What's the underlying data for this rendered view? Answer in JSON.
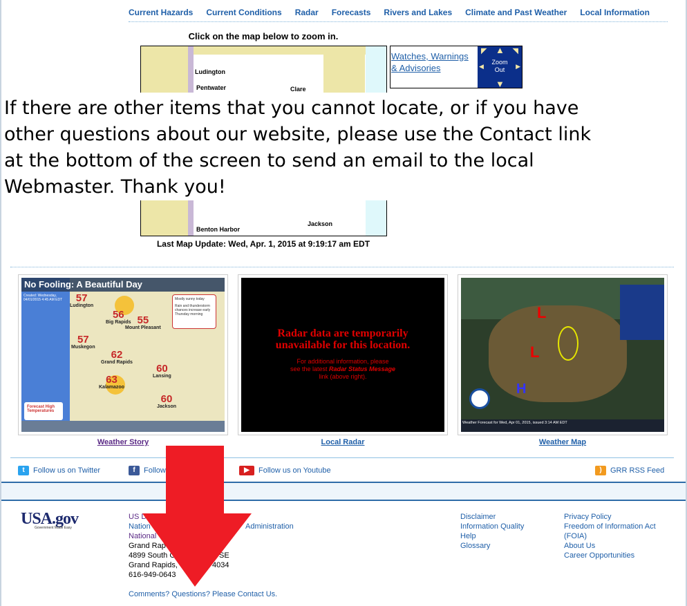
{
  "nav": [
    "Current Hazards",
    "Current Conditions",
    "Radar",
    "Forecasts",
    "Rivers and Lakes",
    "Climate and Past Weather",
    "Local Information"
  ],
  "map": {
    "instruction": "Click on the map below to zoom in.",
    "cities": [
      "Ludington",
      "Pentwater",
      "Clare",
      "Benton Harbor",
      "Jackson"
    ],
    "watches_link": "Watches, Warnings & Advisories",
    "zoom_out": "Zoom Out",
    "last_update": "Last Map Update: Wed, Apr. 1, 2015 at 9:19:17 am EDT"
  },
  "overlay_text": "If there are other items that you cannot locate, or if you have other questions about our website, please use the Contact link at the bottom of the screen to send an email to the local Webmaster. Thank you!",
  "panels": {
    "story": {
      "title": "No Fooling: A Beautiful Day",
      "created": "Created: Wednesday, 04/01/2015 4:45 AM EDT",
      "note1": "Mostly sunny today",
      "note2": "Rain and thunderstorm chances increase early Thursday morning",
      "legend": "Forecast High Temperatures",
      "temps": [
        {
          "v": "57",
          "c": "Ludington"
        },
        {
          "v": "56",
          "c": "Big Rapids"
        },
        {
          "v": "55",
          "c": "Mount Pleasant"
        },
        {
          "v": "57",
          "c": "Muskegon"
        },
        {
          "v": "62",
          "c": "Grand Rapids"
        },
        {
          "v": "60",
          "c": "Lansing"
        },
        {
          "v": "63",
          "c": "Kalamazoo"
        },
        {
          "v": "60",
          "c": "Jackson"
        }
      ],
      "label": "Weather Story"
    },
    "radar": {
      "headline": "Radar data are temporarily unavailable for this location.",
      "line1": "For additional information, please",
      "line2a": "see the latest ",
      "line2b": "Radar Status Message",
      "line3": "link (above right).",
      "label": "Local Radar"
    },
    "map": {
      "caption": "Weather Forecast for Wed, Apr 01, 2015, issued 3:14 AM EDT",
      "label": "Weather Map"
    }
  },
  "social": {
    "twitter": "Follow us on Twitter",
    "facebook": "Follow",
    "youtube": "Follow us on Youtube",
    "rss": "GRR RSS Feed"
  },
  "footer": {
    "usagov": "USA.gov",
    "usagov_tag": "Government Made Easy",
    "addr": [
      "US D",
      "Nation",
      "Administration",
      "National",
      "Grand Rap",
      "4899 South C",
      "SE",
      "Grand Rapids,",
      "4034",
      "616-949-0643"
    ],
    "contact": "Comments? Questions? Please Contact Us.",
    "col2": [
      "Disclaimer",
      "Information Quality",
      "Help",
      "Glossary"
    ],
    "col3": [
      "Privacy Policy",
      "Freedom of Information Act (FOIA)",
      "About Us",
      "Career Opportunities"
    ]
  },
  "colors": {
    "link": "#1f5fa8",
    "arrow": "#ee1c25",
    "radar_text": "#e00000"
  }
}
